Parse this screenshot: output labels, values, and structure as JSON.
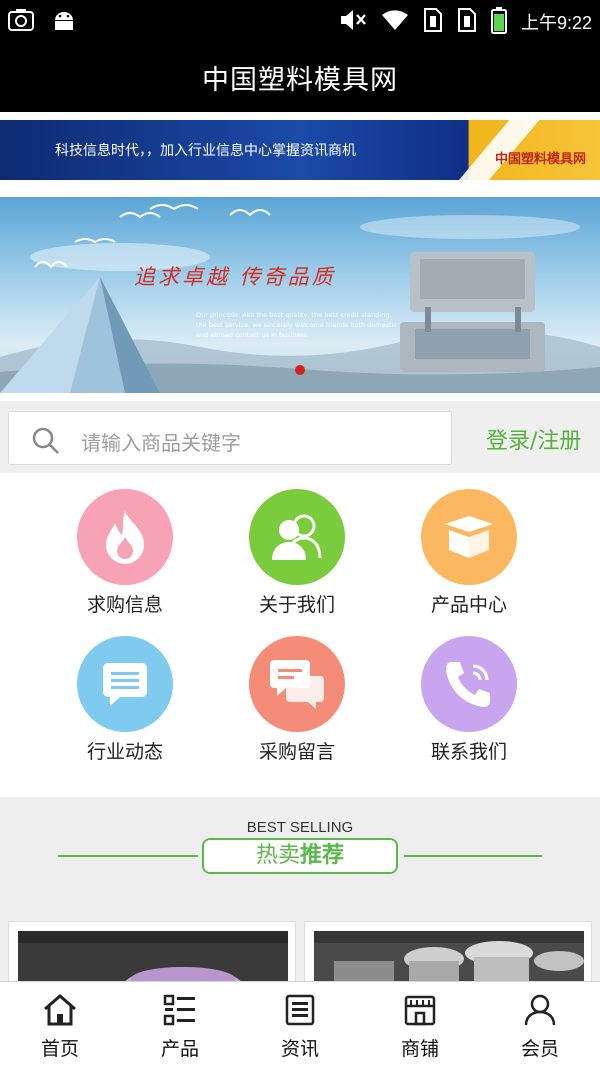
{
  "status_bar": {
    "time": "上午9:22",
    "icons": [
      "camera-icon",
      "android-icon",
      "mute-icon",
      "wifi-icon",
      "sim1-icon",
      "sim2-icon",
      "battery-icon"
    ]
  },
  "app": {
    "title": "中国塑料模具网"
  },
  "ad_banner": {
    "text": "科技信息时代，，加入行业信息中心掌握资讯商机",
    "brand": "中国塑料模具网",
    "colors": {
      "blue": "#1b4aa8",
      "gold": "#f6c53a"
    }
  },
  "hero": {
    "slogan": "追求卓越 传奇品质",
    "caption": "Our principle: Aka the best quality, the best credit standing, the best service, we sincerely welcome friends both domestic and abroad contact us in business.",
    "carousel_dot_active": 1
  },
  "search": {
    "placeholder": "请输入商品关键字",
    "login_label": "登录/注册",
    "accent": "#55b33b"
  },
  "grid": {
    "items": [
      {
        "label": "求购信息",
        "icon": "flame-icon",
        "color": "#f7a2b5"
      },
      {
        "label": "关于我们",
        "icon": "people-icon",
        "color": "#7bcc3c"
      },
      {
        "label": "产品中心",
        "icon": "box-icon",
        "color": "#fcb860"
      },
      {
        "label": "行业动态",
        "icon": "message-icon",
        "color": "#7fcbef"
      },
      {
        "label": "采购留言",
        "icon": "chat-bubbles-icon",
        "color": "#f58c78"
      },
      {
        "label": "联系我们",
        "icon": "phone-icon",
        "color": "#c8a5ee"
      }
    ]
  },
  "best_selling": {
    "en": "BEST SELLING",
    "cn_normal": "热卖",
    "cn_bold": "推荐",
    "color": "#5bb84a"
  },
  "bottom_nav": {
    "items": [
      {
        "label": "首页",
        "icon": "home-icon"
      },
      {
        "label": "产品",
        "icon": "list-icon"
      },
      {
        "label": "资讯",
        "icon": "news-icon"
      },
      {
        "label": "商铺",
        "icon": "store-icon"
      },
      {
        "label": "会员",
        "icon": "user-icon"
      }
    ]
  }
}
